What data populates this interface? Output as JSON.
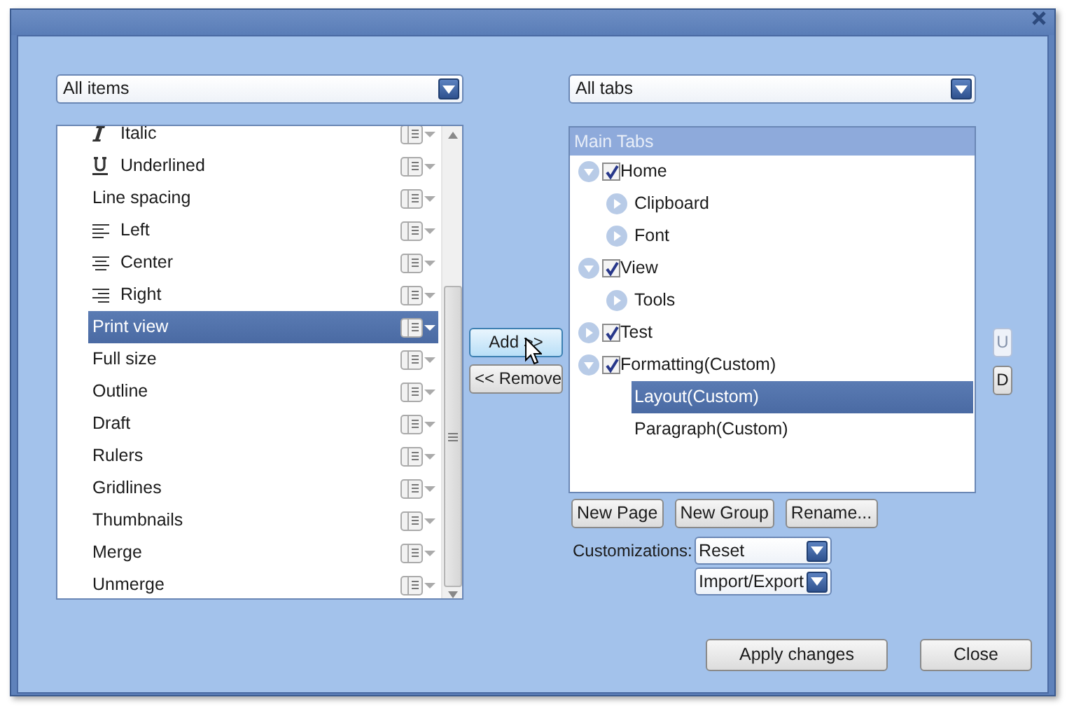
{
  "items_filter": {
    "value": "All items"
  },
  "items": [
    {
      "label": "Italic",
      "kind": "italic",
      "selected": false
    },
    {
      "label": "Underlined",
      "kind": "underline",
      "selected": false
    },
    {
      "label": "Line spacing",
      "kind": "plain",
      "selected": false
    },
    {
      "label": "Left",
      "kind": "alignleft",
      "selected": false
    },
    {
      "label": "Center",
      "kind": "aligncenter",
      "selected": false
    },
    {
      "label": "Right",
      "kind": "alignright",
      "selected": false
    },
    {
      "label": "Print view",
      "kind": "plain",
      "selected": true
    },
    {
      "label": "Full size",
      "kind": "plain",
      "selected": false
    },
    {
      "label": "Outline",
      "kind": "plain",
      "selected": false
    },
    {
      "label": "Draft",
      "kind": "plain",
      "selected": false
    },
    {
      "label": "Rulers",
      "kind": "plain",
      "selected": false
    },
    {
      "label": "Gridlines",
      "kind": "plain",
      "selected": false
    },
    {
      "label": "Thumbnails",
      "kind": "plain",
      "selected": false
    },
    {
      "label": "Merge",
      "kind": "plain",
      "selected": false
    },
    {
      "label": "Unmerge",
      "kind": "plain",
      "selected": false
    }
  ],
  "transfer_buttons": [
    "Add >>",
    "<< Remove"
  ],
  "tabs_filter": {
    "value": "All tabs"
  },
  "tree": {
    "header": "Main Tabs",
    "nodes": [
      {
        "label": "Home",
        "checked": true,
        "expanded": true,
        "selected": false,
        "children": [
          {
            "label": "Clipboard",
            "expanded": false,
            "selected": false
          },
          {
            "label": "Font",
            "expanded": false,
            "selected": false
          }
        ]
      },
      {
        "label": "View",
        "checked": true,
        "expanded": true,
        "selected": false,
        "children": [
          {
            "label": "Tools",
            "expanded": false,
            "selected": false
          }
        ]
      },
      {
        "label": "Test",
        "checked": true,
        "expanded": false,
        "selected": false
      },
      {
        "label": "Formatting(Custom)",
        "checked": true,
        "expanded": true,
        "selected": false,
        "children": [
          {
            "label": "Layout(Custom)",
            "selected": true
          },
          {
            "label": "Paragraph(Custom)",
            "selected": false
          }
        ]
      }
    ]
  },
  "move_buttons": [
    {
      "label": "U",
      "disabled": true
    },
    {
      "label": "D",
      "disabled": false
    }
  ],
  "tree_buttons": [
    "New Page",
    "New Group",
    "Rename..."
  ],
  "customizations": {
    "label": "Customizations:",
    "dropdowns": [
      "Reset",
      "Import/Export"
    ]
  },
  "footer_buttons": [
    "Apply changes",
    "Close"
  ]
}
